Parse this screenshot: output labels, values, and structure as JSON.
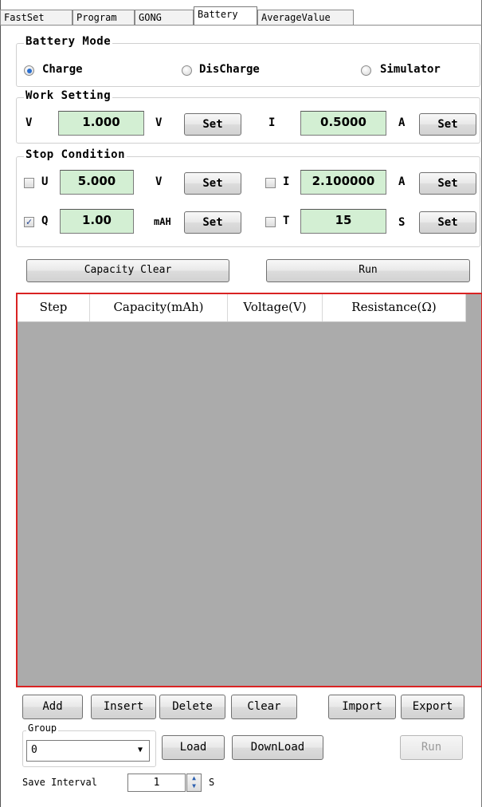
{
  "tabs": [
    "FastSet",
    "Program",
    "GONG",
    "Battery",
    "AverageValue"
  ],
  "active_tab": "Battery",
  "battery_mode": {
    "title": "Battery Mode",
    "options": [
      "Charge",
      "DisCharge",
      "Simulator"
    ],
    "selected": "Charge"
  },
  "work_setting": {
    "title": "Work Setting",
    "v_label": "V",
    "v_value": "1.000",
    "v_unit": "V",
    "i_label": "I",
    "i_value": "0.5000",
    "i_unit": "A",
    "set_label": "Set"
  },
  "stop_condition": {
    "title": "Stop Condition",
    "u": {
      "label": "U",
      "value": "5.000",
      "unit": "V",
      "checked": false
    },
    "i": {
      "label": "I",
      "value": "2.100000",
      "unit": "A",
      "checked": false
    },
    "q": {
      "label": "Q",
      "value": "1.00",
      "unit": "mAH",
      "checked": true
    },
    "t": {
      "label": "T",
      "value": "15",
      "unit": "S",
      "checked": false
    },
    "set_label": "Set"
  },
  "actions": {
    "capacity_clear": "Capacity Clear",
    "run": "Run"
  },
  "table": {
    "columns": [
      "Step",
      "Capacity(mAh)",
      "Voltage(V)",
      "Resistance(Ω)"
    ],
    "rows": []
  },
  "table_buttons": [
    "Add",
    "Insert",
    "Delete",
    "Clear",
    "Import",
    "Export"
  ],
  "group": {
    "label": "Group",
    "value": "0",
    "load": "Load",
    "download": "DownLoad",
    "run": "Run"
  },
  "save_interval": {
    "label": "Save Interval",
    "value": "1",
    "unit": "S"
  },
  "colors": {
    "field_bg": "#d3efd3",
    "table_border": "#d92323",
    "table_bg": "#ababab",
    "radio_dot": "#2a6fd0"
  }
}
